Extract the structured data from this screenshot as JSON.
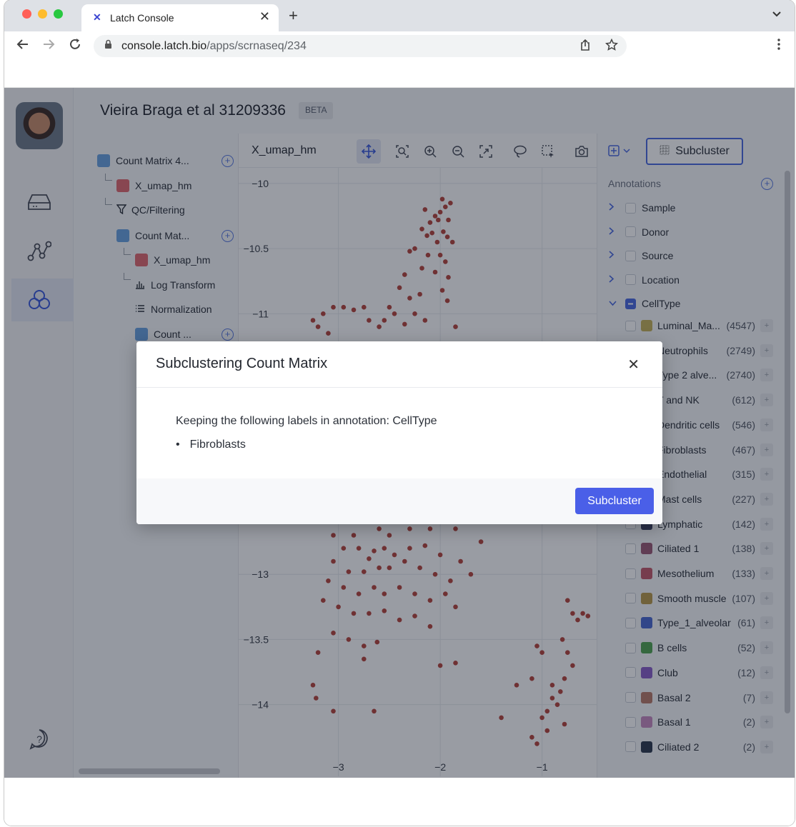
{
  "browser": {
    "tab_title": "Latch Console",
    "tab_favicon": "latch-logo-icon",
    "close_glyph": "✕",
    "new_tab_glyph": "+",
    "tab_menu_glyph": "⌄",
    "url_host": "console.latch.bio",
    "url_path": "/apps/scrnaseq/234"
  },
  "app": {
    "project_title": "Vieira Braga et al 31209336",
    "badge": "BETA"
  },
  "tree": {
    "items": [
      {
        "label": "Count Matrix 4...",
        "icon": "matrix-icon"
      },
      {
        "label": "X_umap_hm",
        "icon": "embedding-icon"
      },
      {
        "label": "QC/Filtering",
        "icon": "filter-icon"
      },
      {
        "label": "Count Mat...",
        "icon": "matrix-icon"
      },
      {
        "label": "X_umap_hm",
        "icon": "embedding-icon"
      },
      {
        "label": "Log Transform",
        "icon": "bar-chart-icon"
      },
      {
        "label": "Normalization",
        "icon": "list-icon"
      },
      {
        "label": "Count ...",
        "icon": "matrix-icon"
      }
    ]
  },
  "plot": {
    "name": "X_umap_hm",
    "tools": [
      "pan-icon",
      "box-zoom-icon",
      "zoom-in-icon",
      "zoom-out-icon",
      "autoscale-icon",
      "lasso-icon",
      "box-select-icon",
      "camera-icon"
    ]
  },
  "chart_data": {
    "type": "scatter",
    "x_ticks": [
      "−3",
      "−2",
      "−1"
    ],
    "y_ticks": [
      "−10",
      "−10.5",
      "−11",
      "−13",
      "−13.5",
      "−14"
    ],
    "xlim": [
      -3.98,
      -0.45
    ],
    "ylim": [
      -14.55,
      -9.88
    ],
    "point_color": "#b5453d",
    "points": [
      [
        -2.15,
        -10.2
      ],
      [
        -2.1,
        -10.3
      ],
      [
        -2.05,
        -10.25
      ],
      [
        -2.0,
        -10.22
      ],
      [
        -1.95,
        -10.18
      ],
      [
        -1.98,
        -10.12
      ],
      [
        -2.02,
        -10.28
      ],
      [
        -1.9,
        -10.15
      ],
      [
        -1.92,
        -10.28
      ],
      [
        -2.18,
        -10.35
      ],
      [
        -2.13,
        -10.4
      ],
      [
        -2.08,
        -10.38
      ],
      [
        -2.03,
        -10.45
      ],
      [
        -1.97,
        -10.37
      ],
      [
        -1.93,
        -10.41
      ],
      [
        -1.88,
        -10.45
      ],
      [
        -2.25,
        -10.5
      ],
      [
        -2.3,
        -10.52
      ],
      [
        -2.12,
        -10.55
      ],
      [
        -2.0,
        -10.55
      ],
      [
        -1.95,
        -10.6
      ],
      [
        -2.18,
        -10.65
      ],
      [
        -2.35,
        -10.7
      ],
      [
        -2.05,
        -10.68
      ],
      [
        -1.92,
        -10.72
      ],
      [
        -2.4,
        -10.8
      ],
      [
        -2.3,
        -10.88
      ],
      [
        -2.2,
        -10.85
      ],
      [
        -1.98,
        -10.82
      ],
      [
        -1.93,
        -10.9
      ],
      [
        -2.5,
        -10.95
      ],
      [
        -2.75,
        -10.95
      ],
      [
        -2.95,
        -10.95
      ],
      [
        -3.05,
        -10.95
      ],
      [
        -2.85,
        -10.97
      ],
      [
        -2.45,
        -11.0
      ],
      [
        -2.55,
        -11.05
      ],
      [
        -2.7,
        -11.05
      ],
      [
        -2.25,
        -11.0
      ],
      [
        -2.15,
        -11.05
      ],
      [
        -3.15,
        -11.0
      ],
      [
        -3.25,
        -11.05
      ],
      [
        -3.1,
        -11.15
      ],
      [
        -3.2,
        -11.1
      ],
      [
        -2.6,
        -11.1
      ],
      [
        -2.35,
        -11.08
      ],
      [
        -1.85,
        -11.1
      ],
      [
        -2.6,
        -12.65
      ],
      [
        -2.5,
        -12.7
      ],
      [
        -2.3,
        -12.65
      ],
      [
        -2.1,
        -12.65
      ],
      [
        -1.85,
        -12.65
      ],
      [
        -2.85,
        -12.7
      ],
      [
        -3.05,
        -12.7
      ],
      [
        -2.8,
        -12.8
      ],
      [
        -2.95,
        -12.8
      ],
      [
        -2.65,
        -12.82
      ],
      [
        -2.7,
        -12.88
      ],
      [
        -2.55,
        -12.8
      ],
      [
        -2.45,
        -12.85
      ],
      [
        -2.3,
        -12.8
      ],
      [
        -2.15,
        -12.78
      ],
      [
        -2.0,
        -12.85
      ],
      [
        -1.8,
        -12.9
      ],
      [
        -1.6,
        -12.75
      ],
      [
        -3.05,
        -12.9
      ],
      [
        -2.9,
        -12.98
      ],
      [
        -2.75,
        -12.98
      ],
      [
        -2.6,
        -12.95
      ],
      [
        -2.5,
        -12.95
      ],
      [
        -2.35,
        -12.9
      ],
      [
        -2.2,
        -12.95
      ],
      [
        -2.05,
        -13.0
      ],
      [
        -1.9,
        -13.05
      ],
      [
        -1.7,
        -13.0
      ],
      [
        -3.1,
        -13.05
      ],
      [
        -2.95,
        -13.1
      ],
      [
        -2.8,
        -13.15
      ],
      [
        -2.65,
        -13.1
      ],
      [
        -2.55,
        -13.15
      ],
      [
        -2.4,
        -13.1
      ],
      [
        -2.25,
        -13.15
      ],
      [
        -2.1,
        -13.2
      ],
      [
        -1.95,
        -13.15
      ],
      [
        -1.85,
        -13.25
      ],
      [
        -3.15,
        -13.2
      ],
      [
        -3.0,
        -13.25
      ],
      [
        -2.85,
        -13.3
      ],
      [
        -2.7,
        -13.3
      ],
      [
        -2.55,
        -13.28
      ],
      [
        -2.4,
        -13.35
      ],
      [
        -2.25,
        -13.32
      ],
      [
        -2.1,
        -13.4
      ],
      [
        -3.05,
        -13.45
      ],
      [
        -2.9,
        -13.5
      ],
      [
        -2.75,
        -13.55
      ],
      [
        -2.62,
        -13.52
      ],
      [
        -3.2,
        -13.6
      ],
      [
        -2.75,
        -13.65
      ],
      [
        -2.0,
        -13.7
      ],
      [
        -1.85,
        -13.68
      ],
      [
        -1.05,
        -13.55
      ],
      [
        -1.0,
        -13.6
      ],
      [
        -0.75,
        -13.2
      ],
      [
        -0.7,
        -13.3
      ],
      [
        -0.65,
        -13.35
      ],
      [
        -0.6,
        -13.3
      ],
      [
        -0.55,
        -13.32
      ],
      [
        -0.8,
        -13.5
      ],
      [
        -0.75,
        -13.6
      ],
      [
        -0.7,
        -13.7
      ],
      [
        -0.78,
        -13.8
      ],
      [
        -0.82,
        -13.9
      ],
      [
        -0.9,
        -13.95
      ],
      [
        -0.85,
        -14.0
      ],
      [
        -0.95,
        -14.05
      ],
      [
        -1.0,
        -14.1
      ],
      [
        -0.78,
        -14.15
      ],
      [
        -0.9,
        -13.85
      ],
      [
        -1.1,
        -13.8
      ],
      [
        -1.25,
        -13.85
      ],
      [
        -1.4,
        -14.1
      ],
      [
        -0.95,
        -14.2
      ],
      [
        -1.1,
        -14.25
      ],
      [
        -1.05,
        -14.3
      ],
      [
        -3.25,
        -13.85
      ],
      [
        -3.22,
        -13.95
      ],
      [
        -3.05,
        -14.05
      ],
      [
        -2.65,
        -14.05
      ]
    ]
  },
  "annotations": {
    "title": "Annotations",
    "groups": [
      {
        "label": "Sample",
        "expanded": false
      },
      {
        "label": "Donor",
        "expanded": false
      },
      {
        "label": "Source",
        "expanded": false
      },
      {
        "label": "Location",
        "expanded": false
      },
      {
        "label": "CellType",
        "expanded": true
      }
    ],
    "subcluster_label": "Subcluster",
    "celltypes": [
      {
        "label": "Luminal_Ma...",
        "count": "(4547)",
        "color": "#c5b15a"
      },
      {
        "label": "Neutrophils",
        "count": "(2749)",
        "color": "#d07070"
      },
      {
        "label": "Type 2 alve...",
        "count": "(2740)",
        "color": "#5b8bd6"
      },
      {
        "label": "T and NK",
        "count": "(612)",
        "color": "#5aa05a"
      },
      {
        "label": "Dendritic cells",
        "count": "(546)",
        "color": "#8a6ac7"
      },
      {
        "label": "Fibroblasts",
        "count": "(467)",
        "color": "#b98b6b"
      },
      {
        "label": "Endothelial",
        "count": "(315)",
        "color": "#c27db8"
      },
      {
        "label": "Mast cells",
        "count": "(227)",
        "color": "#444a5a"
      },
      {
        "label": "Lymphatic",
        "count": "(142)",
        "color": "#3d4361"
      },
      {
        "label": "Ciliated 1",
        "count": "(138)",
        "color": "#9b5a76"
      },
      {
        "label": "Mesothelium",
        "count": "(133)",
        "color": "#c35b6b"
      },
      {
        "label": "Smooth muscle",
        "count": "(107)",
        "color": "#b89a4a"
      },
      {
        "label": "Type_1_alveolar",
        "count": "(61)",
        "color": "#4a6ad0"
      },
      {
        "label": "B cells",
        "count": "(52)",
        "color": "#52a452"
      },
      {
        "label": "Club",
        "count": "(12)",
        "color": "#8a5fc8"
      },
      {
        "label": "Basal 2",
        "count": "(7)",
        "color": "#b87a6a"
      },
      {
        "label": "Basal 1",
        "count": "(2)",
        "color": "#c78ac0"
      },
      {
        "label": "Ciliated 2",
        "count": "(2)",
        "color": "#2e3a4f"
      }
    ]
  },
  "modal": {
    "title": "Subclustering Count Matrix",
    "message": "Keeping the following labels in annotation: CellType",
    "labels": [
      "Fibroblasts"
    ],
    "bullet": "•",
    "close_glyph": "✕",
    "button": "Subcluster"
  }
}
